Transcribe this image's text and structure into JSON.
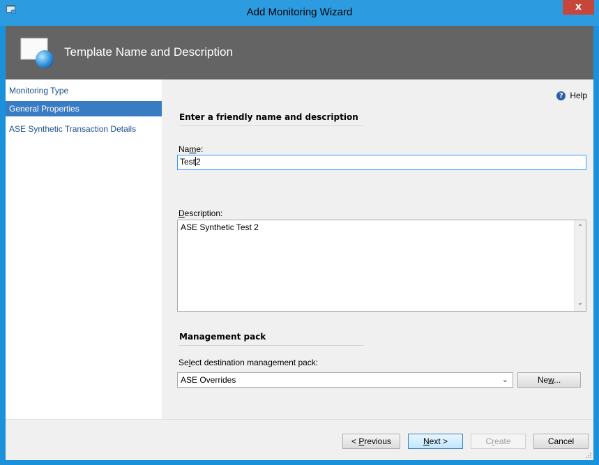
{
  "window": {
    "title": "Add Monitoring Wizard",
    "close_glyph": "x"
  },
  "header": {
    "title": "Template Name and Description"
  },
  "nav": {
    "items": [
      {
        "label": "Monitoring Type",
        "selected": false
      },
      {
        "label": "General Properties",
        "selected": true
      },
      {
        "label": "ASE Synthetic Transaction Details",
        "selected": false
      }
    ]
  },
  "help": {
    "label": "Help",
    "glyph": "?"
  },
  "section1": {
    "title": "Enter a friendly name and description"
  },
  "name_field": {
    "label_pre": "Na",
    "label_ul": "m",
    "label_post": "e:",
    "value_pre": "Test",
    "value_post": "2"
  },
  "description_field": {
    "label_ul": "D",
    "label_post": "escription:",
    "value": "ASE Synthetic Test 2"
  },
  "section2": {
    "title": "Management pack"
  },
  "mp_field": {
    "label_pre": "Se",
    "label_ul": "l",
    "label_post": "ect destination management pack:",
    "value": "ASE Overrides"
  },
  "buttons": {
    "new_pre": "Ne",
    "new_ul": "w",
    "new_post": "...",
    "previous_pre": "< ",
    "previous_ul": "P",
    "previous_post": "revious",
    "next_ul": "N",
    "next_post": "ext >",
    "create_pre": "C",
    "create_ul": "r",
    "create_post": "eate",
    "cancel": "Cancel"
  },
  "colors": {
    "title_bar": "#2c9be0",
    "header_bg": "#646464",
    "nav_selected": "#3a7cc3",
    "close_button": "#c7463c"
  }
}
